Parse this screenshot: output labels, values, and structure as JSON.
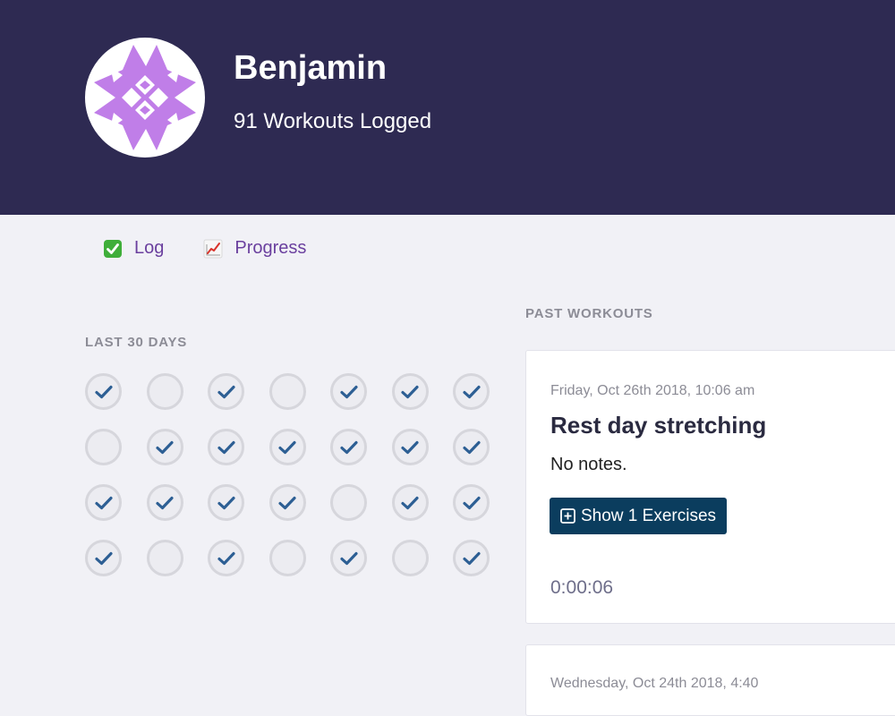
{
  "profile": {
    "name": "Benjamin",
    "workouts_logged": "91 Workouts Logged",
    "avatar_color": "#c07ee8"
  },
  "nav": {
    "log_label": "Log",
    "log_icon": "check-mark-button-icon",
    "progress_label": "Progress",
    "progress_icon": "chart-increasing-icon",
    "accent": "#6a3f9e"
  },
  "calendar": {
    "title": "LAST 30 DAYS",
    "days": [
      true,
      false,
      true,
      false,
      true,
      true,
      true,
      false,
      true,
      true,
      true,
      true,
      true,
      true,
      true,
      true,
      true,
      true,
      false,
      true,
      true,
      true,
      false,
      true,
      false,
      true,
      false,
      true
    ],
    "check_color": "#2d5f94"
  },
  "past_workouts": {
    "title": "PAST WORKOUTS",
    "workouts": [
      {
        "date": "Friday, Oct 26th 2018, 10:06 am",
        "title": "Rest day stretching",
        "notes": "No notes.",
        "show_button": "Show 1 Exercises",
        "duration": "0:00:06"
      },
      {
        "date": "Wednesday, Oct 24th 2018, 4:40"
      }
    ]
  }
}
